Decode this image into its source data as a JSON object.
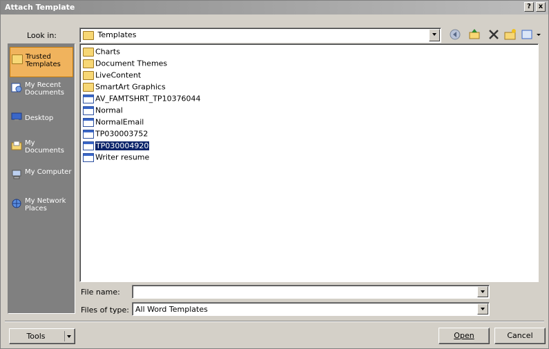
{
  "window": {
    "title": "Attach Template"
  },
  "titlebar": {
    "help": "?",
    "close": "x"
  },
  "look_in": {
    "label": "Look in:",
    "value": "Templates"
  },
  "places": [
    {
      "label": "Trusted Templates",
      "icon": "folder-icon",
      "selected": true
    },
    {
      "label": "My Recent Documents",
      "icon": "recent-documents-icon"
    },
    {
      "label": "Desktop",
      "icon": "desktop-icon"
    },
    {
      "label": "My Documents",
      "icon": "my-documents-icon"
    },
    {
      "label": "My Computer",
      "icon": "computer-icon"
    },
    {
      "label": "My Network Places",
      "icon": "network-icon"
    }
  ],
  "files": [
    {
      "name": "Charts",
      "type": "folder"
    },
    {
      "name": "Document Themes",
      "type": "folder"
    },
    {
      "name": "LiveContent",
      "type": "folder"
    },
    {
      "name": "SmartArt Graphics",
      "type": "folder"
    },
    {
      "name": "AV_FAMTSHRT_TP10376044",
      "type": "doc"
    },
    {
      "name": "Normal",
      "type": "doc"
    },
    {
      "name": "NormalEmail",
      "type": "doc"
    },
    {
      "name": "TP030003752",
      "type": "doc"
    },
    {
      "name": "TP030004920",
      "type": "doc",
      "selected": true
    },
    {
      "name": "Writer resume",
      "type": "doc"
    }
  ],
  "file_name": {
    "label": "File name:",
    "value": ""
  },
  "file_type": {
    "label": "Files of type:",
    "value": "All Word Templates"
  },
  "buttons": {
    "tools": "Tools",
    "open": "Open",
    "cancel": "Cancel"
  },
  "colors": {
    "selection": "#0a246a",
    "selected_place": "#f0b35d",
    "dialog_bg": "#d4d0c8"
  }
}
